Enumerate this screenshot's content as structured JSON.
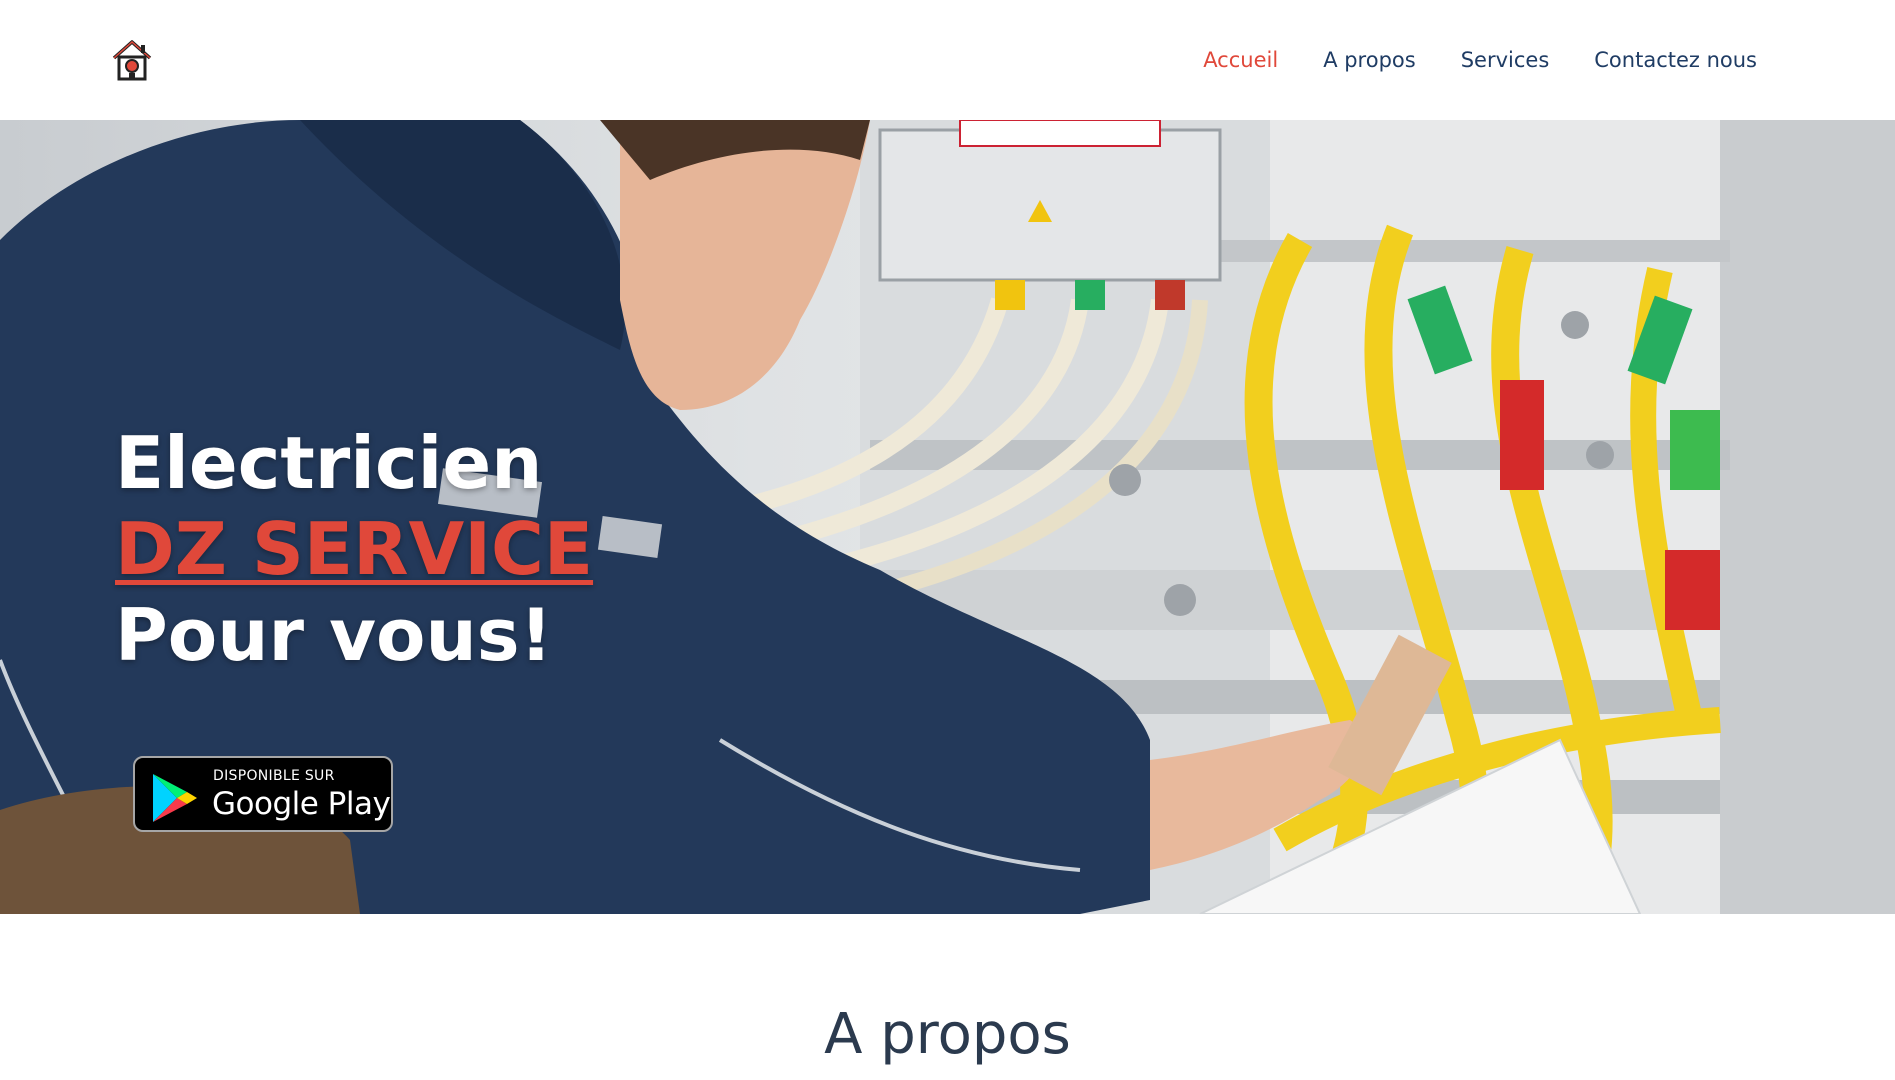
{
  "header": {
    "logo_icon": "house-plug-icon",
    "nav": [
      {
        "label": "Accueil",
        "active": true
      },
      {
        "label": "A propos",
        "active": false
      },
      {
        "label": "Services",
        "active": false
      },
      {
        "label": "Contactez nous",
        "active": false
      }
    ]
  },
  "hero": {
    "line1": "Electricien",
    "line2": "DZ SERVICE",
    "line3": "Pour vous!",
    "badge": {
      "small": "DISPONIBLE SUR",
      "big": "Google Play",
      "icon": "google-play-icon"
    },
    "image": "electrician-working-on-panel-photo"
  },
  "about": {
    "title": "A propos"
  },
  "colors": {
    "accent": "#e0483a",
    "nav_text": "#1f3c64",
    "heading": "#2b3a4e"
  }
}
